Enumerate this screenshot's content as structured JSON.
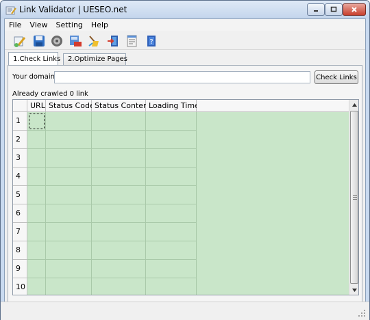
{
  "window": {
    "title": "Link Validator | UESEO.net"
  },
  "menu": [
    "File",
    "View",
    "Setting",
    "Help"
  ],
  "toolbar": {
    "icons": [
      "new-scan-icon",
      "save-icon",
      "settings-icon",
      "export-pdf-icon",
      "clear-icon",
      "exit-icon",
      "report-icon",
      "help-book-icon"
    ]
  },
  "tabs": [
    {
      "label": "1.Check Links",
      "active": true
    },
    {
      "label": "2.Optimize Pages",
      "active": false
    }
  ],
  "form": {
    "domain_label": "Your domain:",
    "domain_value": "",
    "check_button": "Check Links",
    "status": "Already crawled 0 link"
  },
  "grid": {
    "columns": [
      "URL",
      "Status Code",
      "Status Content",
      "Loading Time"
    ],
    "row_numbers": [
      "1",
      "2",
      "3",
      "4",
      "5",
      "6",
      "7",
      "8",
      "9",
      "10"
    ]
  },
  "colors": {
    "grid_background": "#c9e6c9",
    "title_bar": "#c3d5ec",
    "close_button": "#c8402e"
  }
}
